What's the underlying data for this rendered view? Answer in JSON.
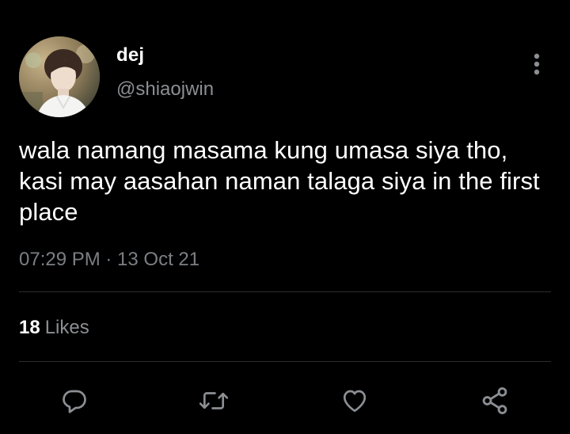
{
  "tweet": {
    "author_name": "dej",
    "author_handle": "@shiaojwin",
    "text": "wala namang masama kung umasa siya tho, kasi may aasahan naman talaga siya in the first place",
    "timestamp": "07:29 PM · 13 Oct 21",
    "likes_count": "18",
    "likes_label": "Likes"
  },
  "icons": {
    "more": "more-vertical-icon",
    "reply": "reply-icon",
    "retweet": "retweet-icon",
    "like": "heart-icon",
    "share": "share-icon"
  },
  "colors": {
    "background": "#000000",
    "text_primary": "#ffffff",
    "text_secondary": "#8b8f93",
    "icon": "#8b8f93",
    "divider": "#2a2d30"
  }
}
